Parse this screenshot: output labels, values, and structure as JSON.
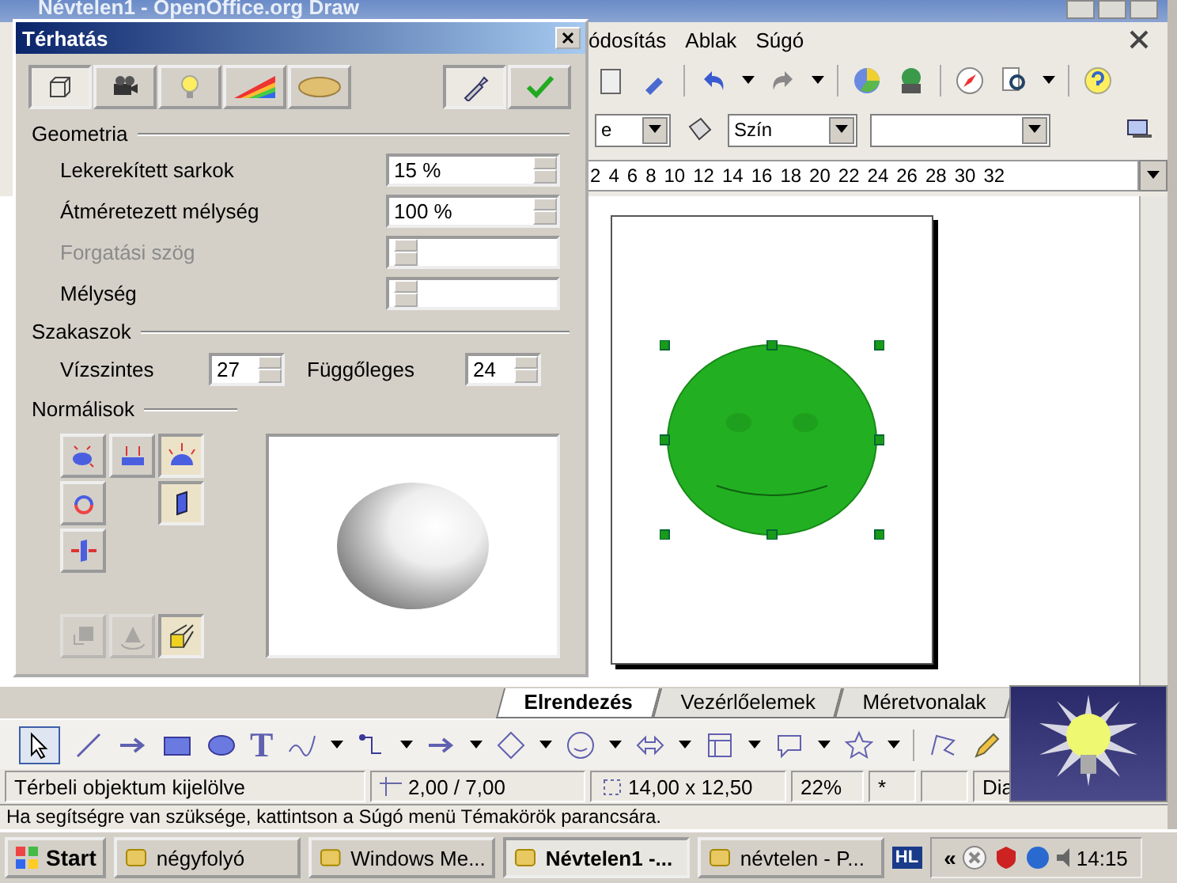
{
  "window": {
    "title": "Névtelen1 - OpenOffice.org Draw"
  },
  "menu": [
    "ódosítás",
    "Ablak",
    "Súgó"
  ],
  "format_bar": {
    "line_style": "e",
    "area_style": "Szín"
  },
  "ruler": [
    "2",
    "4",
    "6",
    "8",
    "10",
    "12",
    "14",
    "16",
    "18",
    "20",
    "22",
    "24",
    "26",
    "28",
    "30",
    "32"
  ],
  "sheet_tabs": [
    {
      "label": "Elrendezés",
      "selected": true
    },
    {
      "label": "Vezérlőelemek",
      "selected": false
    },
    {
      "label": "Méretvonalak",
      "selected": false
    }
  ],
  "draw_toolbar": {
    "text_tool": "T"
  },
  "status_bar": {
    "message": "Térbeli objektum kijelölve",
    "position": "2,00 / 7,00",
    "size": "14,00 x 12,50",
    "zoom": "22%",
    "modified": "*",
    "page": "Dia"
  },
  "help_tip": "Ha segítségre van szüksége, kattintson a Súgó menü Témakörök parancsára.",
  "taskbar": {
    "start": "Start",
    "tasks": [
      {
        "label": "négyfolyó",
        "selected": false
      },
      {
        "label": "Windows Me...",
        "selected": false
      },
      {
        "label": "Névtelen1 -...",
        "selected": true
      },
      {
        "label": "névtelen - P...",
        "selected": false
      }
    ],
    "language": "HL",
    "tray_toggle": "«",
    "clock": "14:15"
  },
  "dialog": {
    "title": "Térhatás",
    "tabs": [
      {
        "kind": "geometry",
        "selected": true
      },
      {
        "kind": "shading",
        "selected": false
      },
      {
        "kind": "lighting",
        "selected": false
      },
      {
        "kind": "textures",
        "selected": false
      },
      {
        "kind": "material",
        "selected": false
      }
    ],
    "geometry": {
      "title": "Geometria",
      "fields": [
        {
          "label": "Lekerekített sarkok",
          "value": "15 %",
          "disabled": false
        },
        {
          "label": "Átméretezett mélység",
          "value": "100 %",
          "disabled": false
        },
        {
          "label": "Forgatási szög",
          "disabled": true
        },
        {
          "label": "Mélység",
          "disabled": false
        }
      ]
    },
    "segments": {
      "title": "Szakaszok",
      "horizontal_label": "Vízszintes",
      "horizontal": "27",
      "vertical_label": "Függőleges",
      "vertical": "24"
    },
    "normals": {
      "title": "Normálisok",
      "rows": [
        [
          {
            "kind": "object",
            "selected": false
          },
          {
            "kind": "flat",
            "selected": false
          },
          {
            "kind": "sphere",
            "selected": true
          }
        ],
        [
          {
            "kind": "invert",
            "selected": false
          },
          null,
          {
            "kind": "double_sided",
            "selected": true
          }
        ],
        [
          {
            "kind": "lighting",
            "selected": false
          }
        ]
      ]
    },
    "actions": [
      {
        "kind": "convert",
        "disabled": true,
        "selected": false
      },
      {
        "kind": "rotate",
        "disabled": true,
        "selected": false
      },
      {
        "kind": "perspective",
        "disabled": false,
        "selected": true
      }
    ]
  }
}
